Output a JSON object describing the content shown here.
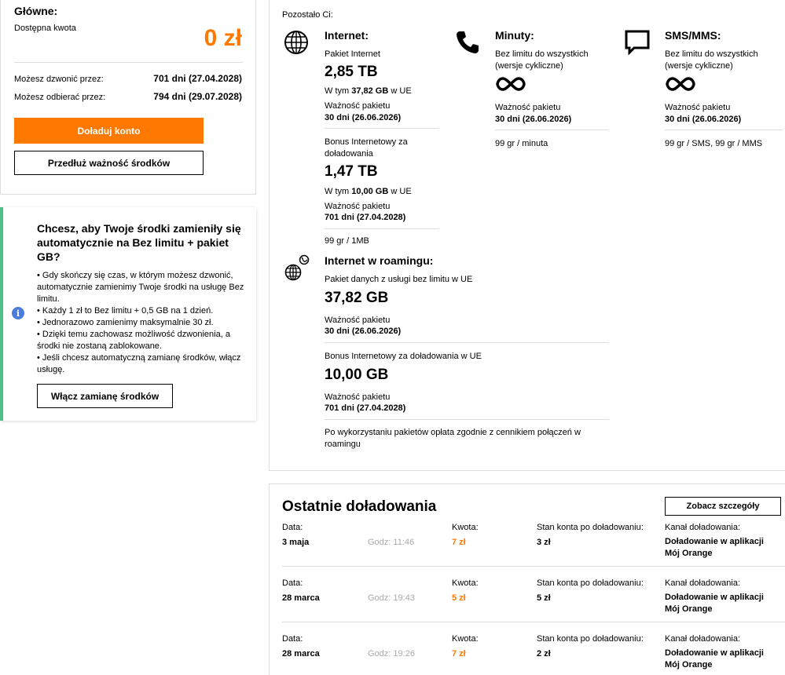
{
  "main_card": {
    "title": "Główne:",
    "available_label": "Dostępna kwota",
    "amount": "0 zł",
    "call_label": "Możesz dzwonić przez:",
    "call_value": "701 dni (27.04.2028)",
    "receive_label": "Możesz odbierać przez:",
    "receive_value": "794 dni (29.07.2028)",
    "topup_button": "Doładuj konto",
    "extend_button": "Przedłuż ważność środków"
  },
  "info_card": {
    "title": "Chcesz, aby Twoje środki zamieniły się automatycznie na Bez limitu + pakiet GB?",
    "bullets": [
      "• Gdy skończy się czas, w którym możesz dzwonić, automatycznie zamienimy Twoje środki na usługę Bez limitu.",
      "• Każdy 1 zł to Bez limitu + 0,5 GB na 1 dzień.",
      "• Jednorazowo zamienimy maksymalnie 30 zł.",
      "• Dzięki temu zachowasz możliwość dzwonienia, a środki nie zostaną zablokowane.",
      "• Jeśli chcesz automatyczną zamianę środków, włącz usługę."
    ],
    "button": "Włącz zamianę środków"
  },
  "remaining": {
    "label": "Pozostało Ci:",
    "internet": {
      "title": "Internet:",
      "pkg1_name": "Pakiet Internet",
      "pkg1_amount": "2,85 TB",
      "pkg1_eu_pre": "W tym ",
      "pkg1_eu_val": "37,82 GB",
      "pkg1_eu_post": " w UE",
      "validity_label": "Ważność pakietu",
      "pkg1_validity": "30 dni (26.06.2026)",
      "pkg2_name": "Bonus Internetowy za doładowania",
      "pkg2_amount": "1,47 TB",
      "pkg2_eu_pre": "W tym ",
      "pkg2_eu_val": "10,00 GB",
      "pkg2_eu_post": " w UE",
      "pkg2_validity": "701 dni (27.04.2028)",
      "rate": "99 gr / 1MB"
    },
    "minutes": {
      "title": "Minuty:",
      "desc": "Bez limitu do wszystkich (wersje cykliczne)",
      "validity_label": "Ważność pakietu",
      "validity": "30 dni (26.06.2026)",
      "rate": "99 gr / minuta"
    },
    "sms": {
      "title": "SMS/MMS:",
      "desc": "Bez limitu do wszystkich (wersje cykliczne)",
      "validity_label": "Ważność pakietu",
      "validity": "30 dni (26.06.2026)",
      "rate": "99 gr / SMS, 99 gr / MMS"
    },
    "roaming": {
      "title": "Internet w roamingu:",
      "pkg1_name": "Pakiet danych z usługi bez limitu w UE",
      "pkg1_amount": "37,82 GB",
      "validity_label": "Ważność pakietu",
      "pkg1_validity": "30 dni (26.06.2026)",
      "pkg2_name": "Bonus Internetowy za doładowania w UE",
      "pkg2_amount": "10,00 GB",
      "pkg2_validity": "701 dni (27.04.2028)",
      "note": "Po wykorzystaniu pakietów opłata zgodnie z cennikiem połączeń w roamingu"
    }
  },
  "recent": {
    "title": "Ostatnie doładowania",
    "details_button": "Zobacz szczegóły",
    "labels": {
      "date": "Data:",
      "amount": "Kwota:",
      "balance": "Stan konta po doładowaniu:",
      "channel": "Kanał doładowania:"
    },
    "rows": [
      {
        "date": "3 maja",
        "time": "Godz: 11:46",
        "amount": "7 zł",
        "balance": "3 zł",
        "channel": "Doładowanie w aplikacji Mój Orange"
      },
      {
        "date": "28 marca",
        "time": "Godz: 19:43",
        "amount": "5 zł",
        "balance": "5 zł",
        "channel": "Doładowanie w aplikacji Mój Orange"
      },
      {
        "date": "28 marca",
        "time": "Godz: 19:26",
        "amount": "7 zł",
        "balance": "2 zł",
        "channel": "Doładowanie w aplikacji Mój Orange"
      }
    ]
  },
  "colors": {
    "accent": "#ff7900",
    "info_bar": "#50be87",
    "info_icon": "#4b7bdc"
  }
}
